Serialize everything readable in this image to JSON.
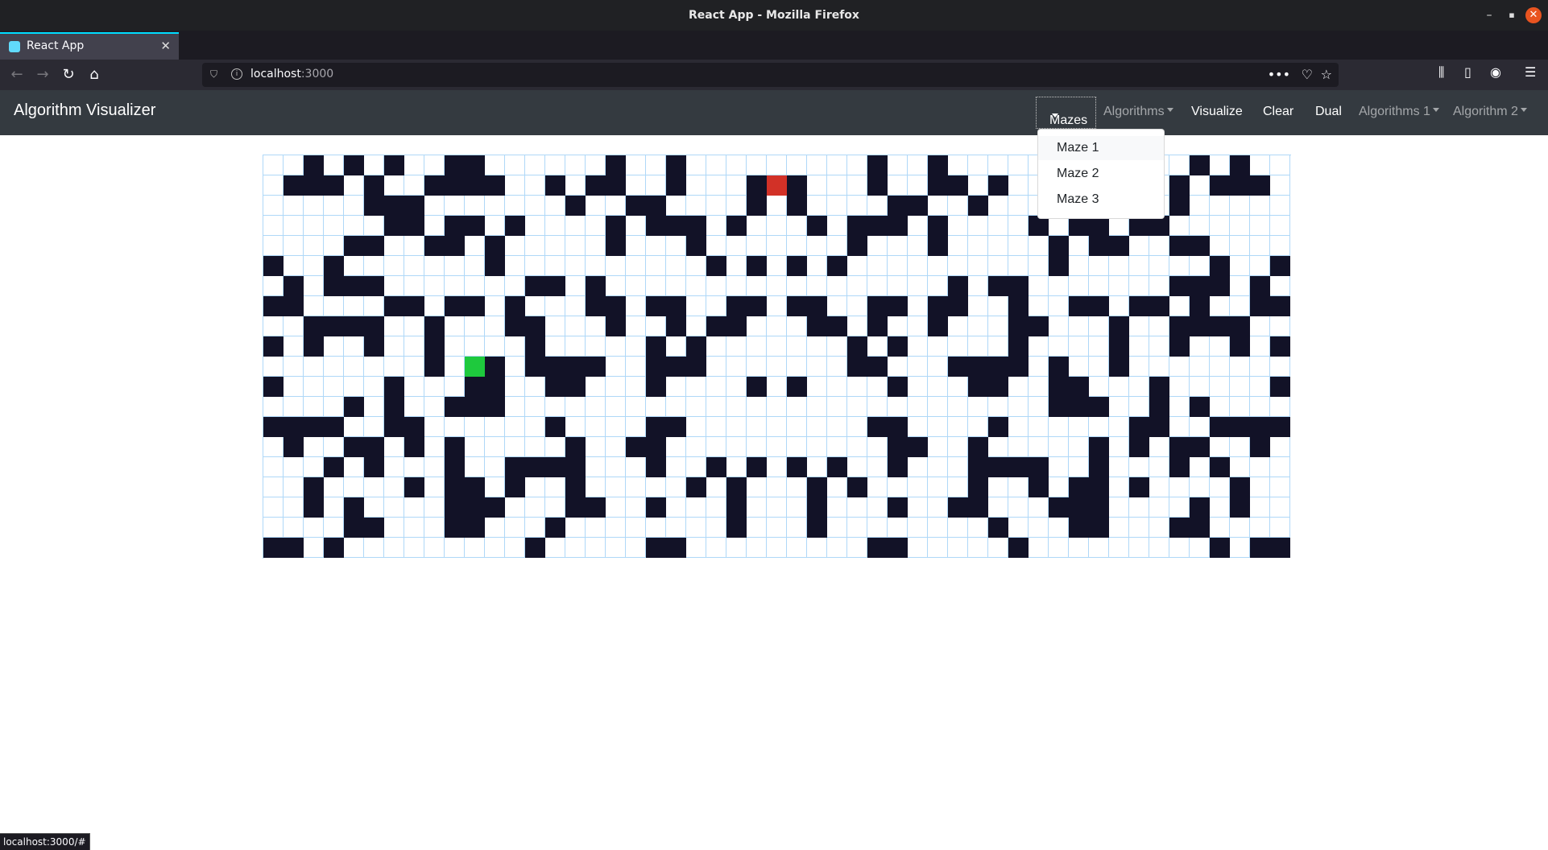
{
  "browser": {
    "window_title": "React App - Mozilla Firefox",
    "tab_title": "React App",
    "url_host": "localhost",
    "url_port": ":3000",
    "status_url": "localhost:3000/#"
  },
  "app": {
    "brand": "Algorithm Visualizer",
    "nav": {
      "mazes": "Mazes",
      "algorithms": "Algorithms",
      "visualize": "Visualize",
      "clear": "Clear",
      "dual": "Dual",
      "algorithms_1": "Algorithms 1",
      "algorithm_2": "Algorithm 2"
    },
    "mazes_menu": [
      "Maze 1",
      "Maze 2",
      "Maze 3"
    ]
  },
  "colors": {
    "wall": "#121227",
    "start": "#1ec93d",
    "end": "#d23127",
    "grid_line": "#afd8f8",
    "app_navbar": "#343a40"
  },
  "grid": {
    "rows": 20,
    "cols": 51,
    "start": [
      10,
      10
    ],
    "end": [
      1,
      25
    ],
    "walls": [
      [
        0,
        2
      ],
      [
        0,
        4
      ],
      [
        0,
        6
      ],
      [
        0,
        9
      ],
      [
        0,
        10
      ],
      [
        0,
        17
      ],
      [
        0,
        20
      ],
      [
        0,
        30
      ],
      [
        0,
        33
      ],
      [
        0,
        43
      ],
      [
        0,
        46
      ],
      [
        0,
        48
      ],
      [
        1,
        1
      ],
      [
        1,
        2
      ],
      [
        1,
        3
      ],
      [
        1,
        5
      ],
      [
        1,
        8
      ],
      [
        1,
        9
      ],
      [
        1,
        10
      ],
      [
        1,
        11
      ],
      [
        1,
        14
      ],
      [
        1,
        16
      ],
      [
        1,
        17
      ],
      [
        1,
        20
      ],
      [
        1,
        24
      ],
      [
        1,
        26
      ],
      [
        1,
        30
      ],
      [
        1,
        33
      ],
      [
        1,
        34
      ],
      [
        1,
        36
      ],
      [
        1,
        45
      ],
      [
        1,
        47
      ],
      [
        1,
        48
      ],
      [
        1,
        49
      ],
      [
        2,
        5
      ],
      [
        2,
        6
      ],
      [
        2,
        7
      ],
      [
        2,
        15
      ],
      [
        2,
        18
      ],
      [
        2,
        19
      ],
      [
        2,
        24
      ],
      [
        2,
        26
      ],
      [
        2,
        31
      ],
      [
        2,
        32
      ],
      [
        2,
        35
      ],
      [
        2,
        45
      ],
      [
        3,
        6
      ],
      [
        3,
        7
      ],
      [
        3,
        9
      ],
      [
        3,
        10
      ],
      [
        3,
        12
      ],
      [
        3,
        17
      ],
      [
        3,
        19
      ],
      [
        3,
        20
      ],
      [
        3,
        21
      ],
      [
        3,
        23
      ],
      [
        3,
        27
      ],
      [
        3,
        29
      ],
      [
        3,
        30
      ],
      [
        3,
        31
      ],
      [
        3,
        33
      ],
      [
        3,
        38
      ],
      [
        3,
        40
      ],
      [
        3,
        41
      ],
      [
        3,
        43
      ],
      [
        3,
        44
      ],
      [
        4,
        4
      ],
      [
        4,
        5
      ],
      [
        4,
        8
      ],
      [
        4,
        9
      ],
      [
        4,
        11
      ],
      [
        4,
        17
      ],
      [
        4,
        21
      ],
      [
        4,
        29
      ],
      [
        4,
        33
      ],
      [
        4,
        39
      ],
      [
        4,
        41
      ],
      [
        4,
        42
      ],
      [
        4,
        45
      ],
      [
        4,
        46
      ],
      [
        5,
        0
      ],
      [
        5,
        3
      ],
      [
        5,
        11
      ],
      [
        5,
        22
      ],
      [
        5,
        24
      ],
      [
        5,
        26
      ],
      [
        5,
        28
      ],
      [
        5,
        39
      ],
      [
        5,
        47
      ],
      [
        5,
        50
      ],
      [
        6,
        1
      ],
      [
        6,
        3
      ],
      [
        6,
        4
      ],
      [
        6,
        5
      ],
      [
        6,
        13
      ],
      [
        6,
        14
      ],
      [
        6,
        16
      ],
      [
        6,
        34
      ],
      [
        6,
        36
      ],
      [
        6,
        37
      ],
      [
        6,
        45
      ],
      [
        6,
        46
      ],
      [
        6,
        47
      ],
      [
        6,
        49
      ],
      [
        7,
        0
      ],
      [
        7,
        1
      ],
      [
        7,
        6
      ],
      [
        7,
        7
      ],
      [
        7,
        9
      ],
      [
        7,
        10
      ],
      [
        7,
        12
      ],
      [
        7,
        16
      ],
      [
        7,
        17
      ],
      [
        7,
        19
      ],
      [
        7,
        20
      ],
      [
        7,
        23
      ],
      [
        7,
        24
      ],
      [
        7,
        26
      ],
      [
        7,
        27
      ],
      [
        7,
        30
      ],
      [
        7,
        31
      ],
      [
        7,
        33
      ],
      [
        7,
        34
      ],
      [
        7,
        37
      ],
      [
        7,
        40
      ],
      [
        7,
        41
      ],
      [
        7,
        43
      ],
      [
        7,
        44
      ],
      [
        7,
        46
      ],
      [
        7,
        49
      ],
      [
        7,
        50
      ],
      [
        8,
        2
      ],
      [
        8,
        3
      ],
      [
        8,
        4
      ],
      [
        8,
        5
      ],
      [
        8,
        8
      ],
      [
        8,
        12
      ],
      [
        8,
        13
      ],
      [
        8,
        17
      ],
      [
        8,
        20
      ],
      [
        8,
        22
      ],
      [
        8,
        23
      ],
      [
        8,
        27
      ],
      [
        8,
        28
      ],
      [
        8,
        30
      ],
      [
        8,
        33
      ],
      [
        8,
        37
      ],
      [
        8,
        38
      ],
      [
        8,
        42
      ],
      [
        8,
        45
      ],
      [
        8,
        46
      ],
      [
        8,
        47
      ],
      [
        8,
        48
      ],
      [
        9,
        0
      ],
      [
        9,
        2
      ],
      [
        9,
        5
      ],
      [
        9,
        8
      ],
      [
        9,
        13
      ],
      [
        9,
        19
      ],
      [
        9,
        21
      ],
      [
        9,
        29
      ],
      [
        9,
        31
      ],
      [
        9,
        37
      ],
      [
        9,
        42
      ],
      [
        9,
        45
      ],
      [
        9,
        48
      ],
      [
        9,
        50
      ],
      [
        10,
        8
      ],
      [
        10,
        11
      ],
      [
        10,
        13
      ],
      [
        10,
        14
      ],
      [
        10,
        15
      ],
      [
        10,
        16
      ],
      [
        10,
        19
      ],
      [
        10,
        20
      ],
      [
        10,
        21
      ],
      [
        10,
        29
      ],
      [
        10,
        30
      ],
      [
        10,
        34
      ],
      [
        10,
        35
      ],
      [
        10,
        36
      ],
      [
        10,
        37
      ],
      [
        10,
        39
      ],
      [
        10,
        42
      ],
      [
        11,
        0
      ],
      [
        11,
        6
      ],
      [
        11,
        10
      ],
      [
        11,
        11
      ],
      [
        11,
        14
      ],
      [
        11,
        15
      ],
      [
        11,
        19
      ],
      [
        11,
        24
      ],
      [
        11,
        26
      ],
      [
        11,
        31
      ],
      [
        11,
        35
      ],
      [
        11,
        36
      ],
      [
        11,
        39
      ],
      [
        11,
        40
      ],
      [
        11,
        44
      ],
      [
        11,
        50
      ],
      [
        12,
        4
      ],
      [
        12,
        6
      ],
      [
        12,
        9
      ],
      [
        12,
        10
      ],
      [
        12,
        11
      ],
      [
        12,
        39
      ],
      [
        12,
        40
      ],
      [
        12,
        41
      ],
      [
        12,
        44
      ],
      [
        12,
        46
      ],
      [
        13,
        0
      ],
      [
        13,
        1
      ],
      [
        13,
        2
      ],
      [
        13,
        3
      ],
      [
        13,
        6
      ],
      [
        13,
        7
      ],
      [
        13,
        14
      ],
      [
        13,
        19
      ],
      [
        13,
        20
      ],
      [
        13,
        30
      ],
      [
        13,
        31
      ],
      [
        13,
        36
      ],
      [
        13,
        43
      ],
      [
        13,
        44
      ],
      [
        13,
        47
      ],
      [
        13,
        48
      ],
      [
        13,
        49
      ],
      [
        13,
        50
      ],
      [
        14,
        1
      ],
      [
        14,
        4
      ],
      [
        14,
        5
      ],
      [
        14,
        7
      ],
      [
        14,
        9
      ],
      [
        14,
        15
      ],
      [
        14,
        18
      ],
      [
        14,
        19
      ],
      [
        14,
        31
      ],
      [
        14,
        32
      ],
      [
        14,
        35
      ],
      [
        14,
        41
      ],
      [
        14,
        43
      ],
      [
        14,
        45
      ],
      [
        14,
        46
      ],
      [
        14,
        49
      ],
      [
        15,
        3
      ],
      [
        15,
        5
      ],
      [
        15,
        9
      ],
      [
        15,
        12
      ],
      [
        15,
        13
      ],
      [
        15,
        14
      ],
      [
        15,
        15
      ],
      [
        15,
        19
      ],
      [
        15,
        22
      ],
      [
        15,
        24
      ],
      [
        15,
        26
      ],
      [
        15,
        28
      ],
      [
        15,
        31
      ],
      [
        15,
        35
      ],
      [
        15,
        36
      ],
      [
        15,
        37
      ],
      [
        15,
        38
      ],
      [
        15,
        41
      ],
      [
        15,
        45
      ],
      [
        15,
        47
      ],
      [
        16,
        2
      ],
      [
        16,
        7
      ],
      [
        16,
        9
      ],
      [
        16,
        10
      ],
      [
        16,
        12
      ],
      [
        16,
        15
      ],
      [
        16,
        21
      ],
      [
        16,
        23
      ],
      [
        16,
        27
      ],
      [
        16,
        29
      ],
      [
        16,
        35
      ],
      [
        16,
        38
      ],
      [
        16,
        40
      ],
      [
        16,
        41
      ],
      [
        16,
        43
      ],
      [
        16,
        48
      ],
      [
        17,
        2
      ],
      [
        17,
        4
      ],
      [
        17,
        9
      ],
      [
        17,
        10
      ],
      [
        17,
        11
      ],
      [
        17,
        15
      ],
      [
        17,
        16
      ],
      [
        17,
        19
      ],
      [
        17,
        23
      ],
      [
        17,
        27
      ],
      [
        17,
        31
      ],
      [
        17,
        34
      ],
      [
        17,
        35
      ],
      [
        17,
        39
      ],
      [
        17,
        40
      ],
      [
        17,
        41
      ],
      [
        17,
        46
      ],
      [
        17,
        48
      ],
      [
        18,
        4
      ],
      [
        18,
        5
      ],
      [
        18,
        9
      ],
      [
        18,
        10
      ],
      [
        18,
        14
      ],
      [
        18,
        23
      ],
      [
        18,
        27
      ],
      [
        18,
        36
      ],
      [
        18,
        40
      ],
      [
        18,
        41
      ],
      [
        18,
        45
      ],
      [
        18,
        46
      ],
      [
        19,
        0
      ],
      [
        19,
        1
      ],
      [
        19,
        3
      ],
      [
        19,
        13
      ],
      [
        19,
        19
      ],
      [
        19,
        20
      ],
      [
        19,
        30
      ],
      [
        19,
        31
      ],
      [
        19,
        37
      ],
      [
        19,
        47
      ],
      [
        19,
        49
      ],
      [
        19,
        50
      ]
    ]
  }
}
